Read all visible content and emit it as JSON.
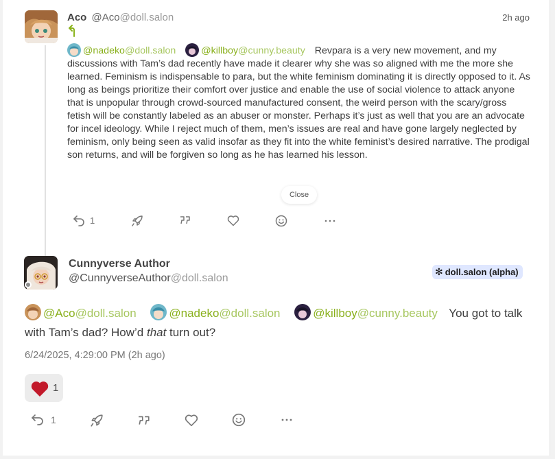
{
  "post1": {
    "author_name": "Aco",
    "author_handle": "@Aco",
    "author_domain": "@doll.salon",
    "time": "2h ago",
    "mentions": [
      {
        "user": "@nadeko",
        "domain": "@doll.salon"
      },
      {
        "user": "@killboy",
        "domain": "@cunny.beauty"
      }
    ],
    "text": "Revpara is a very new movement, and my discussions with Tam’s dad recently have made it clearer why she was so aligned with me the more she learned. Feminism is indispensable to para, but the white feminism dominating it is directly opposed to it. As long as beings prioritize their comfort over justice and enable the use of social violence to attack anyone that is unpopular through crowd-sourced manufactured consent, the weird person with the scary/gross fetish will be constantly labeled as an abuser or monster. Perhaps it’s just as well that you are an advocate for incel ideology. While I reject much of them, men’s issues are real and have gone largely neglected by feminism, only being seen as valid insofar as they fit into the white feminist’s desired narrative. The prodigal son returns, and will be forgiven so long as he has learned his lesson.",
    "close_label": "Close",
    "reply_count": "1"
  },
  "post2": {
    "author_name": "Cunnyverse Author",
    "author_handle": "@CunnyverseAuthor",
    "author_domain": "@doll.salon",
    "instance_badge": "doll.salon (alpha)",
    "mentions": [
      {
        "user": "@Aco",
        "domain": "@doll.salon"
      },
      {
        "user": "@nadeko",
        "domain": "@doll.salon"
      },
      {
        "user": "@killboy",
        "domain": "@cunny.beauty"
      }
    ],
    "text_before": "You got to talk with Tam’s dad? How’d ",
    "text_emph": "that",
    "text_after": " turn out?",
    "timestamp": "6/24/2025, 4:29:00 PM (2h ago)",
    "reaction_count": "1",
    "reply_count": "1"
  },
  "icons": [
    "reply-icon",
    "boost-icon",
    "quote-icon",
    "like-icon",
    "emoji-react-icon",
    "more-icon",
    "heart-icon"
  ],
  "colors": {
    "mention": "#89b01c",
    "mention_domain": "#a7c760",
    "badge_bg": "#dfe7ff",
    "heart": "#c21a2b"
  }
}
